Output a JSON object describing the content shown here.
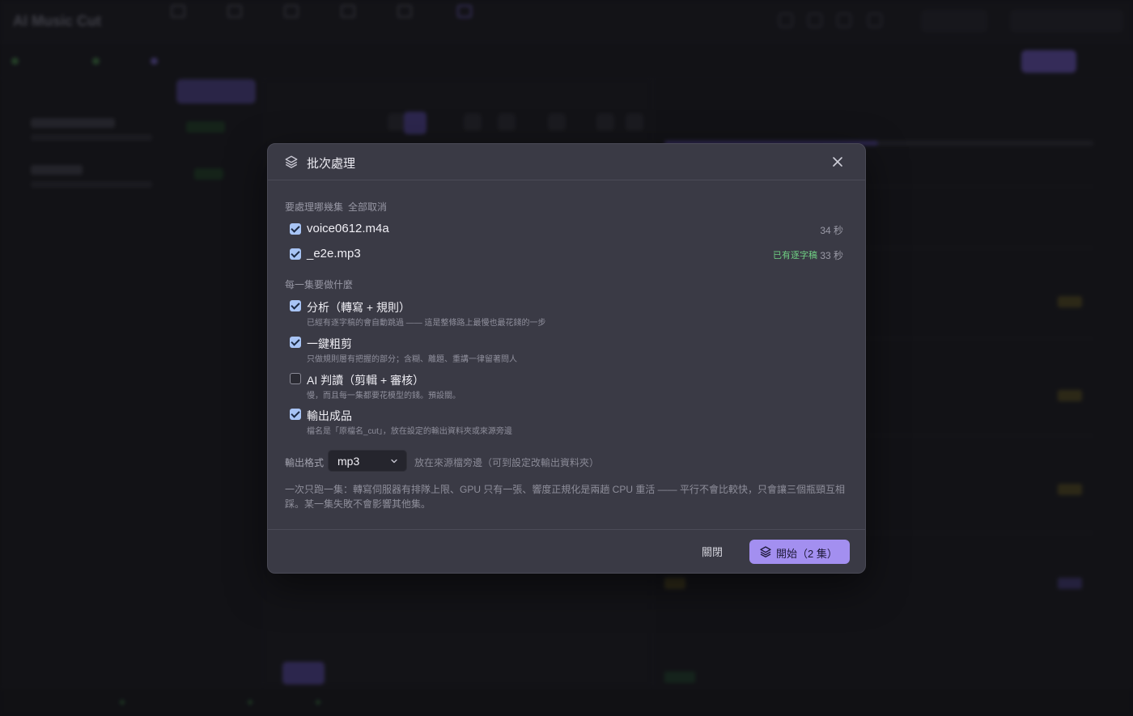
{
  "background": {
    "app_title": "AI Music Cut",
    "status_items": [
      "",
      "",
      "",
      ""
    ]
  },
  "modal": {
    "title": "批次處理",
    "episodes_section": {
      "label": "要處理哪幾集",
      "toggle_all": "全部取消",
      "items": [
        {
          "name": "voice0612.m4a",
          "duration": "34 秒",
          "checked": true,
          "badge": ""
        },
        {
          "name": "_e2e.mp3",
          "duration": "33 秒",
          "checked": true,
          "badge": "已有逐字稿"
        }
      ]
    },
    "actions_section": {
      "label": "每一集要做什麼",
      "options": [
        {
          "title": "分析（轉寫 + 規則）",
          "desc": "已經有逐字稿的會自動跳過 —— 這是整條路上最慢也最花錢的一步",
          "checked": true
        },
        {
          "title": "一鍵粗剪",
          "desc": "只做規則層有把握的部分；含糊、離題、重講一律留著問人",
          "checked": true
        },
        {
          "title": "AI 判讀（剪輯 + 審核）",
          "desc": "慢，而且每一集都要花模型的錢。預設關。",
          "checked": false
        },
        {
          "title": "輸出成品",
          "desc": "檔名是「原檔名_cut」，放在設定的輸出資料夾或來源旁邊",
          "checked": true
        }
      ]
    },
    "format": {
      "label": "輸出格式",
      "value": "mp3",
      "hint": "放在來源檔旁邊（可到設定改輸出資料夾）"
    },
    "note": "一次只跑一集：轉寫伺服器有排隊上限、GPU 只有一張、響度正規化是兩趟 CPU 重活 —— 平行不會比較快，只會讓三個瓶頸互相踩。某一集失敗不會影響其他集。",
    "footer": {
      "close_label": "關閉",
      "start_label": "開始（2 集）"
    },
    "colors": {
      "accent": "#a38ff0",
      "checkbox": "#a8c4f5",
      "badge_green": "#6fcf83"
    }
  }
}
